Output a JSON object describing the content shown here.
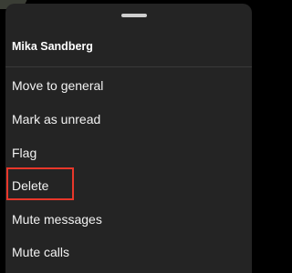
{
  "sheet": {
    "title": "Mika Sandberg",
    "items": [
      {
        "label": "Move to general"
      },
      {
        "label": "Mark as unread"
      },
      {
        "label": "Flag"
      },
      {
        "label": "Delete",
        "highlighted": true
      },
      {
        "label": "Mute messages"
      },
      {
        "label": "Mute calls"
      }
    ]
  },
  "colors": {
    "sheet_background": "#242424",
    "text": "#f2f2f2",
    "highlight_outline": "#e8372a"
  }
}
